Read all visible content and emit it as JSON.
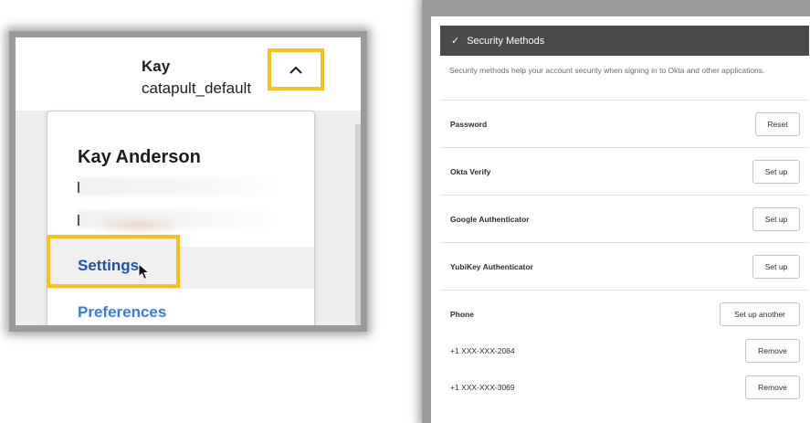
{
  "user_menu": {
    "first_name": "Kay",
    "org": "catapult_default",
    "full_name": "Kay Anderson",
    "items": [
      {
        "label": "Settings"
      },
      {
        "label": "Preferences"
      }
    ]
  },
  "security": {
    "header_title": "Security Methods",
    "description": "Security methods help your account security when signing in to Okta and other applications.",
    "methods": [
      {
        "label": "Password",
        "button": "Reset"
      },
      {
        "label": "Okta Verify",
        "button": "Set up"
      },
      {
        "label": "Google Authenticator",
        "button": "Set up"
      },
      {
        "label": "YubiKey Authenticator",
        "button": "Set up"
      },
      {
        "label": "Phone",
        "button": "Set up another"
      }
    ],
    "phones": [
      {
        "number": "+1 XXX-XXX-2084",
        "button": "Remove"
      },
      {
        "number": "+1 XXX-XXX-3069",
        "button": "Remove"
      }
    ]
  },
  "colors": {
    "highlight": "#f5c21b",
    "header_bg": "#4a4a4a",
    "link": "#1f4fb3"
  },
  "icons": [
    "chevron-up-icon",
    "checkmark-icon",
    "mouse-pointer-icon"
  ]
}
